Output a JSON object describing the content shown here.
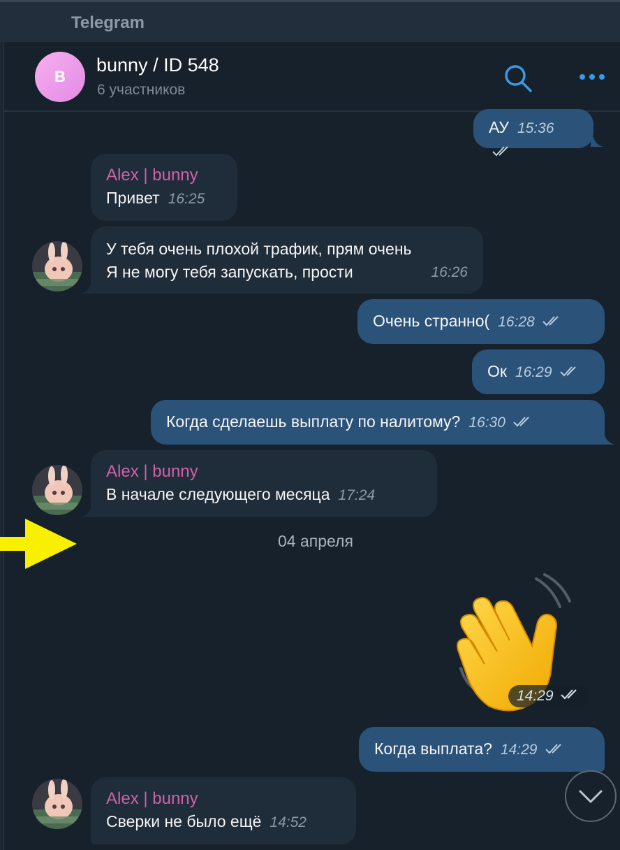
{
  "window": {
    "title": "Telegram"
  },
  "chat": {
    "avatar_letter": "B",
    "name": "bunny / ID 548",
    "subtitle": "6 участников"
  },
  "messages": [
    {
      "dir": "out",
      "text": "АУ",
      "time": "15:36"
    },
    {
      "dir": "in",
      "sender": "Alex | bunny",
      "text": "Привет",
      "time": "16:25"
    },
    {
      "dir": "in",
      "text_line1": "У тебя очень плохой трафик, прям очень",
      "text_line2": "Я не могу тебя запускать, прости",
      "time": "16:26"
    },
    {
      "dir": "out",
      "text": "Очень странно(",
      "time": "16:28"
    },
    {
      "dir": "out",
      "text": "Ок",
      "time": "16:29"
    },
    {
      "dir": "out",
      "text": "Когда сделаешь выплату по налитому?",
      "time": "16:30"
    },
    {
      "dir": "in",
      "sender": "Alex | bunny",
      "text": "В начале следующего месяца",
      "time": "17:24"
    },
    {
      "dir": "out",
      "type": "sticker",
      "time": "14:29"
    },
    {
      "dir": "out",
      "text": "Когда выплата?",
      "time": "14:29"
    },
    {
      "dir": "in",
      "sender": "Alex | bunny",
      "text": "Сверки не было ещё",
      "time": "14:52"
    }
  ],
  "date_separator": "04 апреля",
  "colors": {
    "background": "#17212b",
    "incoming_bubble": "#1f2c3a",
    "outgoing_bubble": "#2b5278",
    "sender_name": "#d062a4",
    "accent": "#3a9be0",
    "annotation_arrow": "#f8f000"
  },
  "icons": {
    "search": "search-icon",
    "more": "more-dots-icon",
    "read": "double-check-icon",
    "scroll": "chevron-down-icon"
  }
}
